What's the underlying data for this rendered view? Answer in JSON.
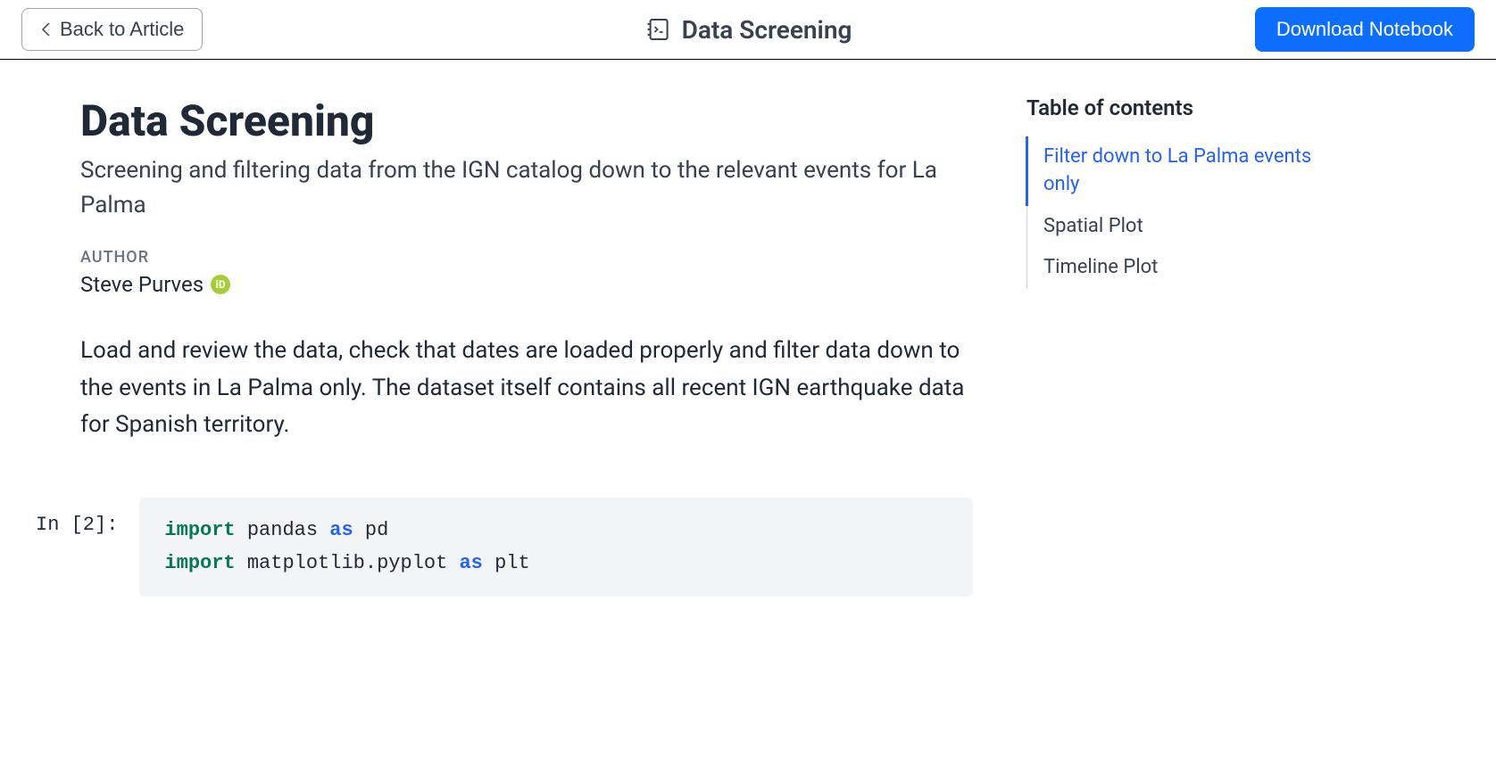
{
  "header": {
    "back_label": "Back to Article",
    "title": "Data Screening",
    "download_label": "Download Notebook"
  },
  "article": {
    "title": "Data Screening",
    "subtitle": "Screening and filtering data from the IGN catalog down to the relevant events for La Palma",
    "author_label": "AUTHOR",
    "author_name": "Steve Purves",
    "description": "Load and review the data, check that dates are loaded properly and filter data down to the events in La Palma only. The dataset itself contains all recent IGN earthquake data for Spanish territory."
  },
  "code": {
    "prompt": "In [2]:",
    "line1_kw": "import",
    "line1_mod": "pandas",
    "line1_as": "as",
    "line1_alias": "pd",
    "line2_kw": "import",
    "line2_mod": "matplotlib.pyplot",
    "line2_as": "as",
    "line2_alias": "plt"
  },
  "toc": {
    "title": "Table of contents",
    "items": [
      "Filter down to La Palma events only",
      "Spatial Plot",
      "Timeline Plot"
    ]
  }
}
